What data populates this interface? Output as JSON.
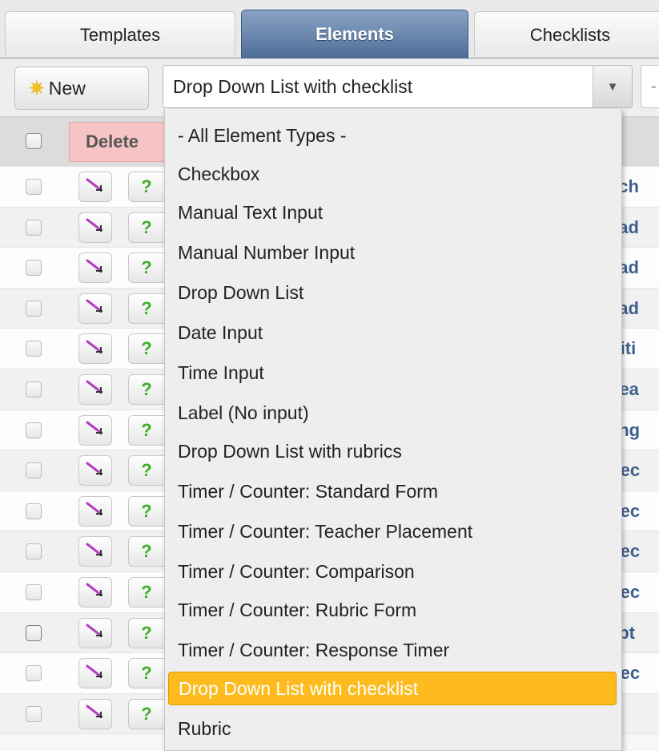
{
  "tabs": [
    {
      "label": "Templates"
    },
    {
      "label": "Elements"
    },
    {
      "label": "Checklists"
    }
  ],
  "active_tab": "Elements",
  "toolbar": {
    "new_label": "New",
    "select_value": "Drop Down List with checklist",
    "select_arrow": "▼",
    "second_select_value": "-"
  },
  "table": {
    "delete_label": "Delete",
    "help_glyph": "?",
    "rows": [
      {
        "name": "ech"
      },
      {
        "name": "ead"
      },
      {
        "name": "ead"
      },
      {
        "name": "ead"
      },
      {
        "name": "/riti"
      },
      {
        "name": "pea"
      },
      {
        "name": "ang"
      },
      {
        "name": "ffec"
      },
      {
        "name": "ffec"
      },
      {
        "name": "ffec"
      },
      {
        "name": "ffec"
      },
      {
        "name": "ept"
      },
      {
        "name": "ffec"
      },
      {
        "name": ""
      }
    ]
  },
  "dropdown": {
    "options": [
      "- All Element Types -",
      "Checkbox",
      "Manual Text Input",
      "Manual Number Input",
      "Drop Down List",
      "Date Input",
      "Time Input",
      "Label (No input)",
      "Drop Down List with rubrics",
      "Timer / Counter: Standard Form",
      "Timer / Counter: Teacher Placement",
      "Timer / Counter: Comparison",
      "Timer / Counter: Rubric Form",
      "Timer / Counter: Response Timer",
      "Drop Down List with checklist",
      "Rubric"
    ],
    "selected": "Drop Down List with checklist"
  },
  "colors": {
    "active_tab": "#5a7aa6",
    "selected_option": "#fdbb1f",
    "delete_bg": "#f6c4c4",
    "name_text": "#3d5f8c"
  },
  "icons": {
    "new": "star-icon",
    "edit": "wand-icon",
    "help": "question-icon",
    "dropdown": "chevron-down-icon"
  }
}
